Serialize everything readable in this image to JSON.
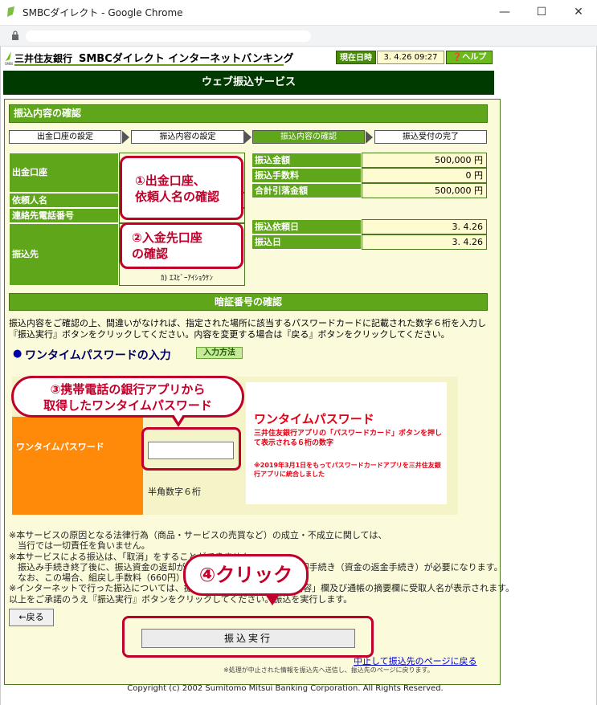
{
  "window": {
    "title": "SMBCダイレクト - Google Chrome",
    "minimize": "—",
    "maximize": "☐",
    "close": "✕"
  },
  "header": {
    "bank_name": "三井住友銀行",
    "service_name": "SMBCダイレクト インターネットバンキング",
    "datetime_label": "現在日時",
    "datetime_value": "3. 4.26 09:27",
    "help_label": "ヘルプ",
    "page_title": "ウェブ振込サービス"
  },
  "confirm": {
    "heading": "振込内容の確認",
    "steps": [
      "出金口座の設定",
      "振込内容の設定",
      "振込内容の確認",
      "振込受付の完了"
    ],
    "current_step": 3
  },
  "left_table": {
    "debit_account_label": "出金口座",
    "requester_label": "依頼人名",
    "phone_label": "連絡先電話番号",
    "payee_label": "振込先",
    "payee_kana": "ｶ) ｴｽﾋﾞｰｱｲｼｮｳｹﾝ"
  },
  "right_table": {
    "rows": [
      {
        "label": "振込金額",
        "value": "500,000 円"
      },
      {
        "label": "振込手数料",
        "value": "0 円"
      },
      {
        "label": "合計引落金額",
        "value": "500,000 円"
      }
    ],
    "dates": [
      {
        "label": "振込依頼日",
        "value": "3. 4.26"
      },
      {
        "label": "振込日",
        "value": "3. 4.26"
      }
    ]
  },
  "pin": {
    "heading": "暗証番号の確認",
    "description_line1": "振込内容をご確認の上、間違いがなければ、指定された場所に該当するパスワードカードに記載された数字６桁を入力し",
    "description_line2": "『振込実行』ボタンをクリックしてください。内容を変更する場合は『戻る』ボタンをクリックしてください。",
    "otp_title": "ワンタイムパスワードの入力",
    "input_method": "入力方法",
    "otp_label": "ワンタイムパスワード",
    "otp_value": "",
    "otp_hint": "半角数字６桁",
    "info_title": "ワンタイムパスワード",
    "info_desc": "三井住友銀行アプリの「パスワードカード」ボタンを押して表示される６桁の数字",
    "info_note": "※2019年3月1日をもってパスワードカードアプリを三井住友銀行アプリに統合しました"
  },
  "notes": [
    "※本サービスの原因となる法律行為（商品・サービスの売買など）の成立・不成立に関しては、",
    "　当行では一切責任を負いません。",
    "※本サービスによる振込は、「取消」をすることができません。",
    "　振込み手続き終了後に、振込資金の返却が必要な場合は、振込先への返却手続き（資金の返金手続き）が必要になります。",
    "　なお、この場合、組戻し手数料（660円）がかかります。",
    "※インターネットで行った振込については、振込先の「振込依頼人名」「内容」欄及び通帳の摘要欄に受取人名が表示されます。",
    "以上をご承諾のうえ『振込実行』ボタンをクリックしてください。振込を実行します。"
  ],
  "buttons": {
    "back": "←戻る",
    "execute": "振込実行",
    "cancel_link": "中止して振込先のページに戻る",
    "cancel_note": "※処理が中止された情報を振込先へ送信し、振込先のページに戻ります。"
  },
  "footer": {
    "copyright": "Copyright (c) 2002 Sumitomo Mitsui Banking Corporation. All Rights Reserved."
  },
  "annotations": {
    "callout1": "①出金口座、依頼人名の確認",
    "callout1_line1": "①出金口座、",
    "callout1_line2": "依頼人名の確認",
    "callout2_line1": "②入金先口座",
    "callout2_line2": "の確認",
    "callout3_line1": "③携帯電話の銀行アプリから",
    "callout3_line2": "取得したワンタイムパスワード",
    "callout4": "④クリック"
  },
  "colors": {
    "brand_green": "#5fa61b",
    "dark_green": "#003a00",
    "annotation_red": "#c0002a",
    "otp_orange": "#ff8a0a"
  }
}
